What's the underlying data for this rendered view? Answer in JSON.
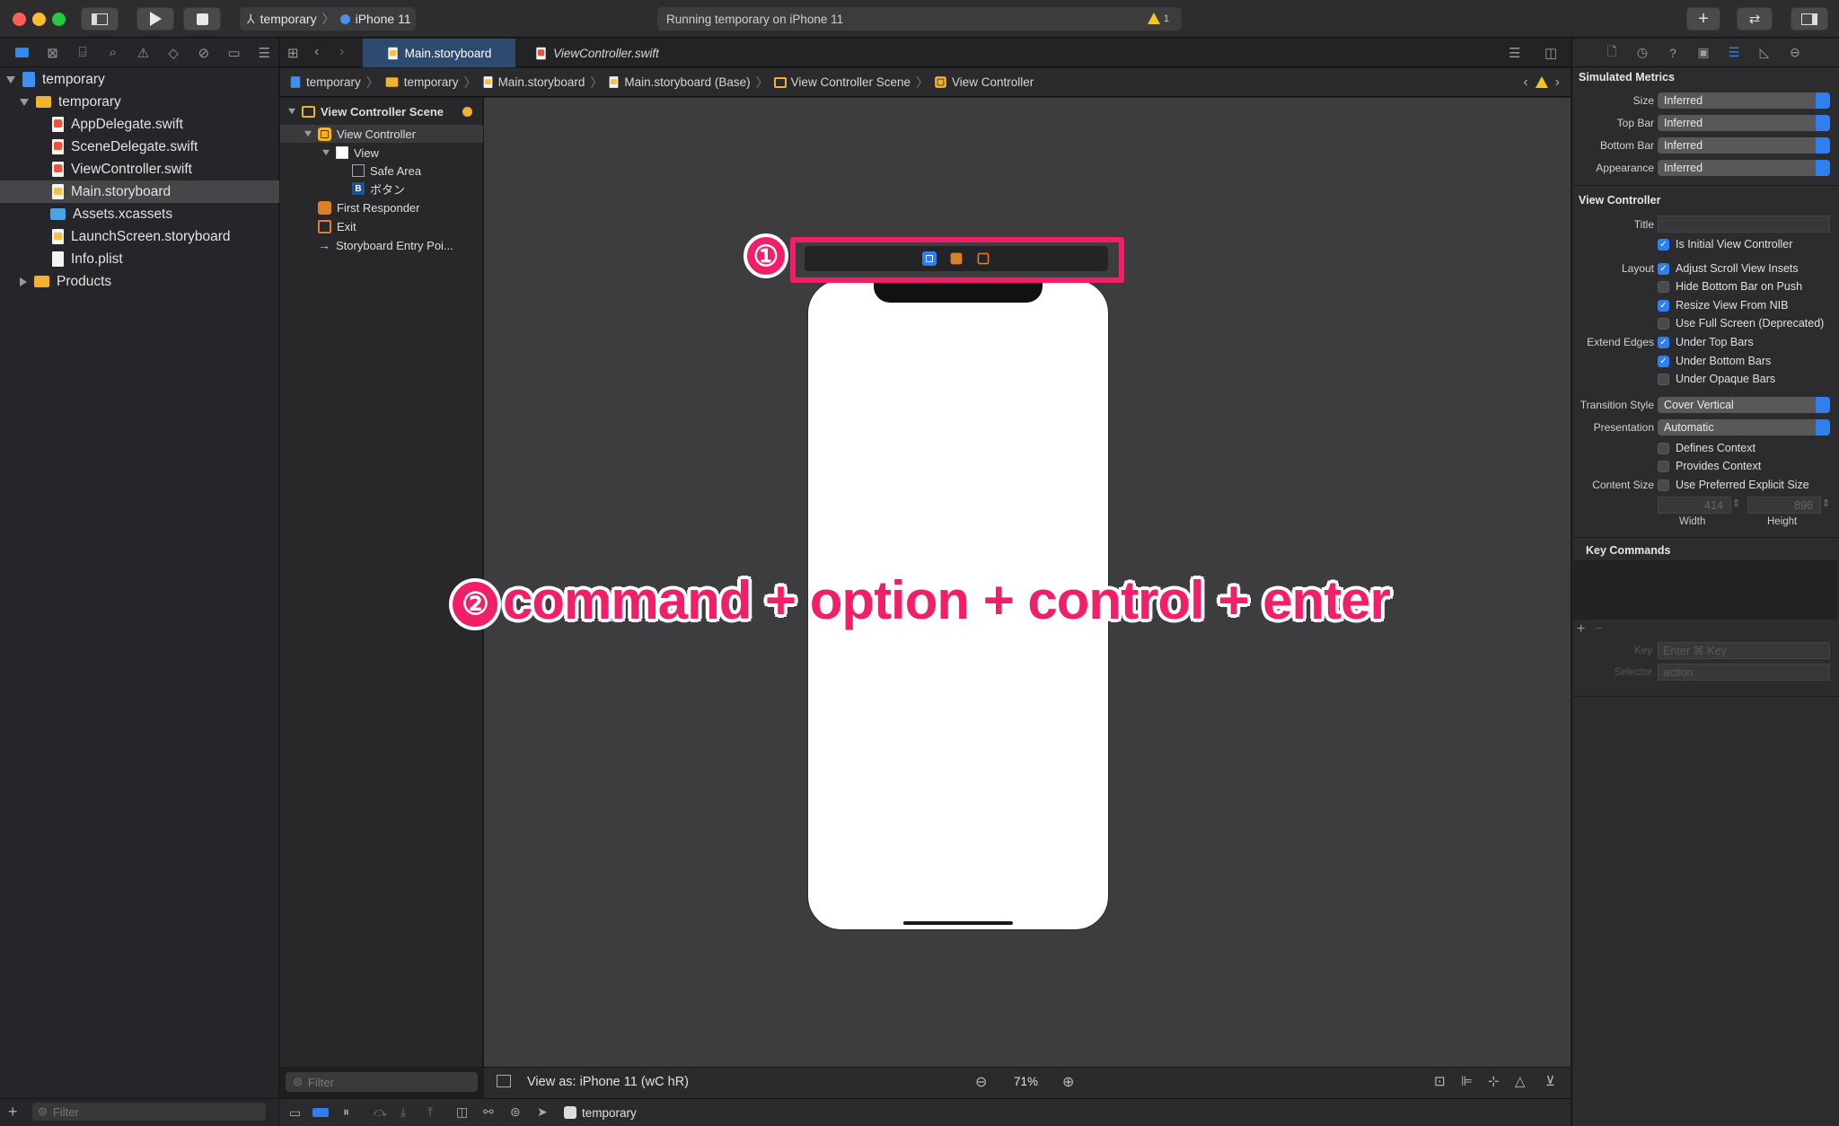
{
  "toolbar": {
    "scheme_project": "temporary",
    "scheme_device": "iPhone 11",
    "activity_text": "Running temporary on iPhone 11",
    "warning_count": "1",
    "colors": {
      "close": "#fe5f57",
      "minimize": "#febc2e",
      "zoom": "#28c840"
    }
  },
  "navigator": {
    "items": [
      {
        "label": "temporary",
        "kind": "project"
      },
      {
        "label": "temporary",
        "kind": "folder"
      },
      {
        "label": "AppDelegate.swift",
        "kind": "swift"
      },
      {
        "label": "SceneDelegate.swift",
        "kind": "swift"
      },
      {
        "label": "ViewController.swift",
        "kind": "swift"
      },
      {
        "label": "Main.storyboard",
        "kind": "storyboard",
        "selected": true
      },
      {
        "label": "Assets.xcassets",
        "kind": "assets"
      },
      {
        "label": "LaunchScreen.storyboard",
        "kind": "storyboard"
      },
      {
        "label": "Info.plist",
        "kind": "plist"
      },
      {
        "label": "Products",
        "kind": "folder"
      }
    ],
    "filter_placeholder": "Filter"
  },
  "tabs": [
    {
      "label": "Main.storyboard",
      "active": true
    },
    {
      "label": "ViewController.swift",
      "active": false
    }
  ],
  "jumpbar": [
    "temporary",
    "temporary",
    "Main.storyboard",
    "Main.storyboard (Base)",
    "View Controller Scene",
    "View Controller"
  ],
  "outline": {
    "scene": "View Controller Scene",
    "vc": "View Controller",
    "view": "View",
    "safe_area": "Safe Area",
    "button": "ボタン",
    "first_responder": "First Responder",
    "exit": "Exit",
    "entry": "Storyboard Entry Poi...",
    "filter_placeholder": "Filter"
  },
  "canvas": {
    "view_as": "View as: iPhone 11 (wC hR)",
    "zoom": "71%",
    "annotation_1": "①",
    "annotation_2_badge": "②",
    "annotation_2_text": "command + option + control + enter",
    "accent": "#f21e6a"
  },
  "debug": {
    "target": "temporary"
  },
  "inspector": {
    "simulated_metrics": "Simulated Metrics",
    "size_label": "Size",
    "size_value": "Inferred",
    "top_bar_label": "Top Bar",
    "top_bar_value": "Inferred",
    "bottom_bar_label": "Bottom Bar",
    "bottom_bar_value": "Inferred",
    "appearance_label": "Appearance",
    "appearance_value": "Inferred",
    "view_controller": "View Controller",
    "title_label": "Title",
    "is_initial": "Is Initial View Controller",
    "layout_label": "Layout",
    "adjust_scroll": "Adjust Scroll View Insets",
    "hide_bottom": "Hide Bottom Bar on Push",
    "resize_nib": "Resize View From NIB",
    "full_screen": "Use Full Screen (Deprecated)",
    "extend_label": "Extend Edges",
    "under_top": "Under Top Bars",
    "under_bottom": "Under Bottom Bars",
    "under_opaque": "Under Opaque Bars",
    "transition_label": "Transition Style",
    "transition_value": "Cover Vertical",
    "presentation_label": "Presentation",
    "presentation_value": "Automatic",
    "defines_context": "Defines Context",
    "provides_context": "Provides Context",
    "content_size_label": "Content Size",
    "preferred_size": "Use Preferred Explicit Size",
    "width_value": "414",
    "height_value": "896",
    "width_label": "Width",
    "height_label": "Height",
    "key_commands": "Key Commands",
    "key_label": "Key",
    "key_placeholder": "Enter ⌘ Key",
    "selector_label": "Selector",
    "selector_placeholder": "action"
  }
}
